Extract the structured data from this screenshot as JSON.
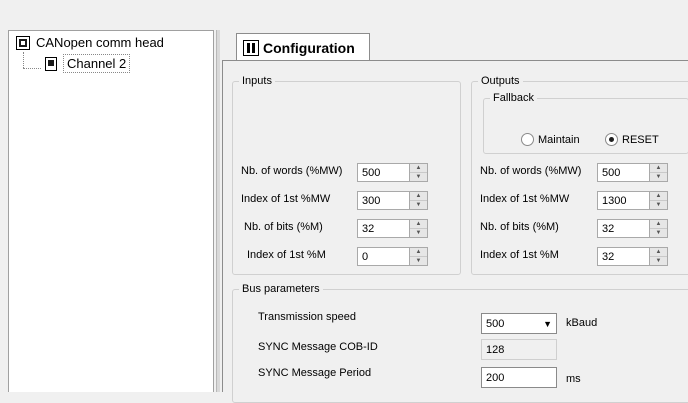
{
  "tree": {
    "root_label": "CANopen comm head",
    "child_label": "Channel 2"
  },
  "tab": {
    "label": "Configuration"
  },
  "inputs": {
    "legend": "Inputs",
    "rows": [
      {
        "label": "Nb. of words (%MW)",
        "value": "500"
      },
      {
        "label": "Index of 1st %MW",
        "value": "300"
      },
      {
        "label": "Nb. of bits (%M)",
        "value": "32"
      },
      {
        "label": "Index of 1st %M",
        "value": "0"
      }
    ]
  },
  "outputs": {
    "legend": "Outputs",
    "fallback": {
      "legend": "Fallback",
      "maintain_label": "Maintain",
      "reset_label": "RESET",
      "selected": "RESET"
    },
    "rows": [
      {
        "label": "Nb. of words (%MW)",
        "value": "500"
      },
      {
        "label": "Index of 1st %MW",
        "value": "1300"
      },
      {
        "label": "Nb. of bits (%M)",
        "value": "32"
      },
      {
        "label": "Index of 1st %M",
        "value": "32"
      }
    ]
  },
  "bus": {
    "legend": "Bus parameters",
    "transmission_speed_label": "Transmission speed",
    "transmission_speed_value": "500",
    "transmission_speed_unit": "kBaud",
    "sync_cob_label": "SYNC Message COB-ID",
    "sync_cob_value": "128",
    "sync_period_label": "SYNC Message Period",
    "sync_period_value": "200",
    "sync_period_unit": "ms"
  }
}
